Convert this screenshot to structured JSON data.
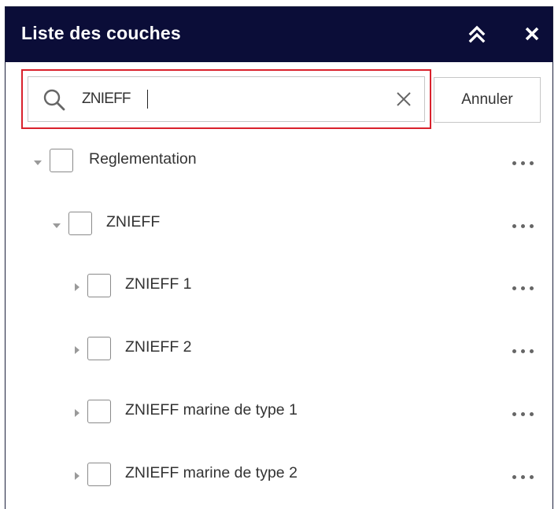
{
  "header": {
    "title": "Liste des couches",
    "collapse_icon": "chevrons-up-icon",
    "close_icon": "close-icon"
  },
  "search": {
    "value": "ZNIEFF",
    "icon": "search-icon",
    "clear_icon": "clear-icon",
    "cancel_label": "Annuler"
  },
  "layers": [
    {
      "label": "Reglementation",
      "expanded": true,
      "checked": false
    },
    {
      "label": "ZNIEFF",
      "expanded": true,
      "checked": false
    },
    {
      "label": "ZNIEFF 1",
      "expanded": false,
      "checked": false
    },
    {
      "label": "ZNIEFF 2",
      "expanded": false,
      "checked": false
    },
    {
      "label": "ZNIEFF marine de type 1",
      "expanded": false,
      "checked": false
    },
    {
      "label": "ZNIEFF marine de type 2",
      "expanded": false,
      "checked": false
    }
  ],
  "colors": {
    "header_bg": "#0b0d38",
    "highlight_outline": "#d9212c"
  }
}
